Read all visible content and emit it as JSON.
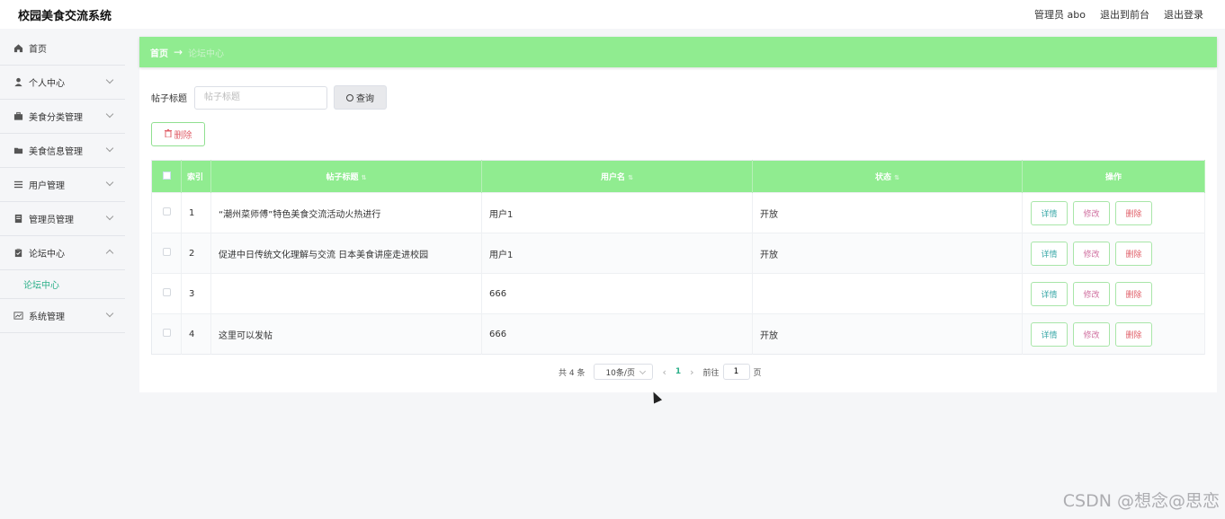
{
  "header": {
    "title": "校园美食交流系统",
    "admin_label": "管理员 abo",
    "to_front_label": "退出到前台",
    "logout_label": "退出登录"
  },
  "sidebar": {
    "items": [
      {
        "label": "首页",
        "icon": "home-icon"
      },
      {
        "label": "个人中心",
        "icon": "user-icon"
      },
      {
        "label": "美食分类管理",
        "icon": "briefcase-icon"
      },
      {
        "label": "美食信息管理",
        "icon": "folder-icon"
      },
      {
        "label": "用户管理",
        "icon": "list-icon"
      },
      {
        "label": "管理员管理",
        "icon": "document-icon"
      },
      {
        "label": "论坛中心",
        "icon": "clipboard-icon"
      },
      {
        "label": "系统管理",
        "icon": "chart-icon"
      }
    ],
    "subitem_forum": "论坛中心"
  },
  "breadcrumb": {
    "home": "首页",
    "arrow": "→",
    "current": "论坛中心"
  },
  "search": {
    "label": "帖子标题",
    "placeholder": "帖子标题",
    "button_label": "查询"
  },
  "delete_button_label": "删除",
  "table": {
    "headers": [
      "索引",
      "帖子标题",
      "用户名",
      "状态",
      "操作"
    ],
    "rows": [
      {
        "index": "1",
        "title": "“潮州菜师傅”特色美食交流活动火热进行",
        "user": "用户1",
        "status": "开放"
      },
      {
        "index": "2",
        "title": "促进中日传统文化理解与交流 日本美食讲座走进校园",
        "user": "用户1",
        "status": "开放"
      },
      {
        "index": "3",
        "title": "",
        "user": "666",
        "status": ""
      },
      {
        "index": "4",
        "title": "这里可以发帖",
        "user": "666",
        "status": "开放"
      }
    ],
    "ops": {
      "detail": "详情",
      "edit": "修改",
      "delete": "删除"
    }
  },
  "pagination": {
    "total": "共 4 条",
    "page_size": "10条/页",
    "prev": "‹",
    "current_page": "1",
    "next": "›",
    "goto_label": "前往",
    "goto_value": "1",
    "page_suffix": "页"
  },
  "watermark": "CSDN @想念@思恋",
  "colors": {
    "accent": "#90ec90",
    "active_text": "#2db08a",
    "danger": "#e0606a"
  }
}
